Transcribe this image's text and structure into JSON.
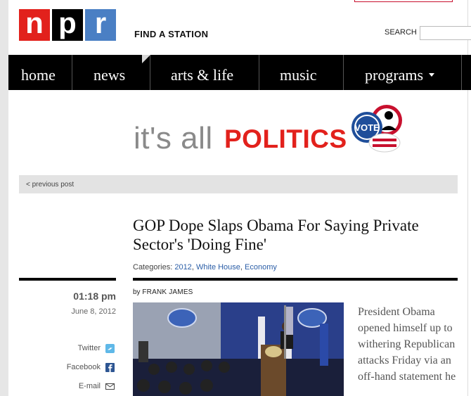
{
  "logo": {
    "letters": [
      "n",
      "p",
      "r"
    ]
  },
  "header": {
    "find_station": "FIND A STATION",
    "search_label": "SEARCH"
  },
  "nav": {
    "items": [
      {
        "label": "home"
      },
      {
        "label": "news"
      },
      {
        "label": "arts & life"
      },
      {
        "label": "music"
      },
      {
        "label": "programs"
      }
    ]
  },
  "banner": {
    "part1": "it's all",
    "part2": "POLITICS",
    "badge": "VOTE"
  },
  "pager": {
    "previous": "< previous post"
  },
  "article": {
    "headline": "GOP Dope Slaps Obama For Saying Private Sector's 'Doing Fine'",
    "categories_label": "Categories:",
    "categories": [
      "2012",
      "White House",
      "Economy"
    ],
    "byline_prefix": "by",
    "author": "FRANK JAMES",
    "time": "01:18 pm",
    "date": "June 8, 2012",
    "body": "President Obama opened himself up to withering Republican attacks Friday via an off-hand statement he"
  },
  "share": [
    {
      "label": "Twitter",
      "icon": "twitter-icon"
    },
    {
      "label": "Facebook",
      "icon": "facebook-icon"
    },
    {
      "label": "E-mail",
      "icon": "email-icon"
    }
  ],
  "colors": {
    "npr_red": "#e2211c",
    "npr_black": "#000000",
    "npr_blue": "#4a7fc4",
    "link": "#2b5ea7",
    "nav_bg": "#000000"
  }
}
